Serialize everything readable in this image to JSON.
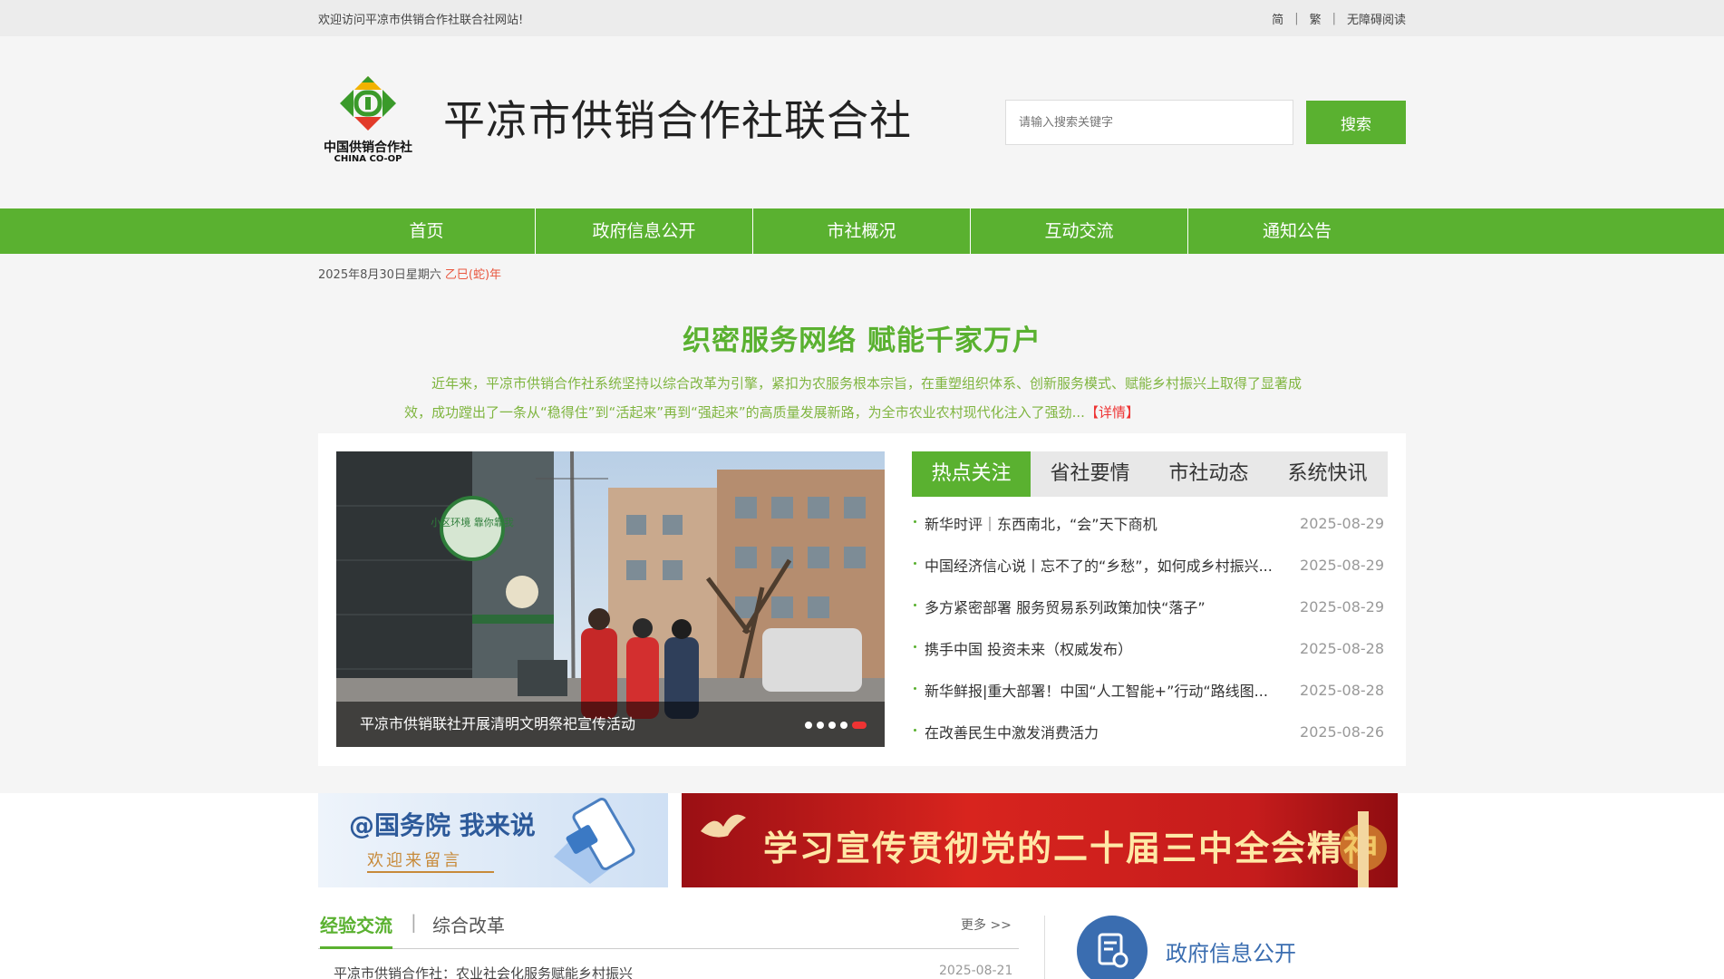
{
  "topbar": {
    "welcome": "欢迎访问平凉市供销合作社联合社网站!",
    "simplified": "简",
    "traditional": "繁",
    "accessible": "无障碍阅读",
    "separator": "|"
  },
  "header": {
    "logo_cn": "中国供销合作社",
    "logo_en": "CHINA CO-OP",
    "site_title": "平凉市供销合作社联合社",
    "search_placeholder": "请输入搜索关键字",
    "search_button": "搜索"
  },
  "nav": {
    "items": [
      {
        "label": "首页"
      },
      {
        "label": "政府信息公开"
      },
      {
        "label": "市社概况"
      },
      {
        "label": "互动交流"
      },
      {
        "label": "通知公告"
      }
    ]
  },
  "date": {
    "date_text": "2025年8月30日星期六",
    "lunar_text": "乙巳(蛇)年"
  },
  "headline": {
    "title": "织密服务网络 赋能千家万户",
    "summary": "近年来，平凉市供销合作社系统坚持以综合改革为引擎，紧扣为农服务根本宗旨，在重塑组织体系、创新服务模式、赋能乡村振兴上取得了显著成效，成功蹚出了一条从“稳得住”到“活起来”再到“强起来”的高质量发展新路，为全市农业农村现代化注入了强劲...",
    "more": "【详情】"
  },
  "slider": {
    "caption": "平凉市供销联社开展清明文明祭祀宣传活动",
    "sign_text": "小区环境 靠你靠我",
    "dots": 5,
    "active_dot": 5
  },
  "news": {
    "tabs": [
      {
        "label": "热点关注",
        "active": true
      },
      {
        "label": "省社要情",
        "active": false
      },
      {
        "label": "市社动态",
        "active": false
      },
      {
        "label": "系统快讯",
        "active": false
      }
    ],
    "items": [
      {
        "title": "新华时评｜东西南北，“会”天下商机",
        "date": "2025-08-29"
      },
      {
        "title": "中国经济信心说丨忘不了的“乡愁”，如何成乡村振兴...",
        "date": "2025-08-29"
      },
      {
        "title": "多方紧密部署 服务贸易系列政策加快“落子”",
        "date": "2025-08-29"
      },
      {
        "title": "携手中国 投资未来（权威发布）",
        "date": "2025-08-28"
      },
      {
        "title": "新华鲜报|重大部署！中国“人工智能+”行动“路线图...",
        "date": "2025-08-28"
      },
      {
        "title": "在改善民生中激发消费活力",
        "date": "2025-08-26"
      }
    ]
  },
  "banners": {
    "left_main": "@国务院 我来说",
    "left_sub": "欢迎来留言",
    "right_main": "学习宣传贯彻党的二十届三中全会精神"
  },
  "section": {
    "tab_active": "经验交流",
    "tab_sep": "|",
    "tab_other": "综合改革",
    "more": "更多 >>",
    "first_item": "平凉市供销合作社：农业社会化服务赋能乡村振兴",
    "first_date": "2025-08-21",
    "gov_title": "政府信息公开"
  },
  "colors": {
    "brand_green": "#5ab130",
    "accent_red": "#e33333",
    "gov_blue": "#3a6db0"
  }
}
